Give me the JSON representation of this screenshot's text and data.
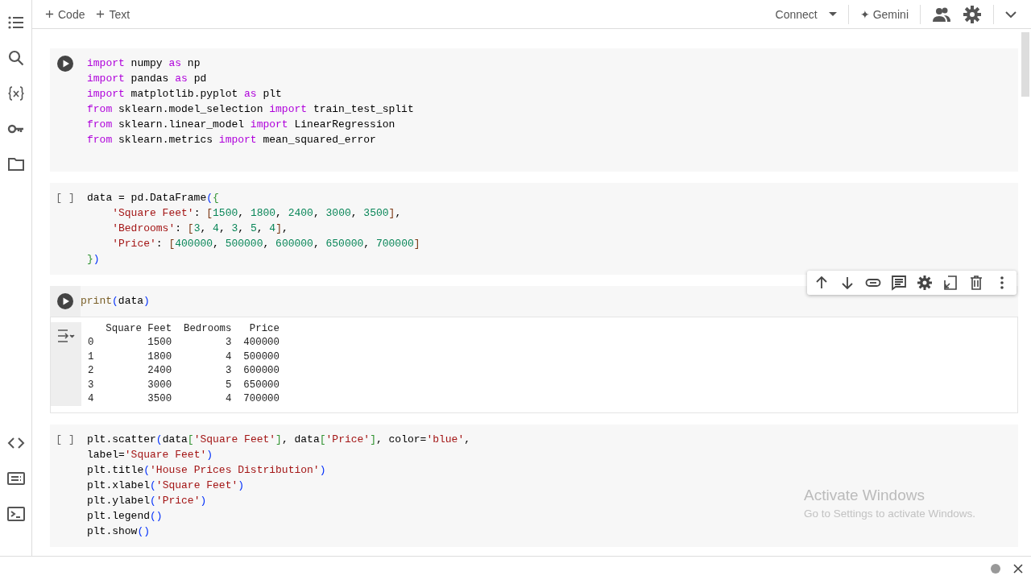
{
  "top_bar": {
    "add_buttons": [
      {
        "label": "Code"
      },
      {
        "label": "Text"
      }
    ],
    "connect": {
      "label": "Connect"
    },
    "gemini": {
      "mark": "✦",
      "label": "Gemini"
    }
  },
  "sidebar": {
    "top_icons": [
      {
        "kind": "toc"
      },
      {
        "kind": "search"
      },
      {
        "kind": "variables"
      },
      {
        "kind": "key"
      },
      {
        "kind": "folder"
      }
    ],
    "bottom_icons": [
      {
        "kind": "code"
      },
      {
        "kind": "command"
      },
      {
        "kind": "terminal"
      }
    ]
  },
  "cells": [
    {
      "selected": false,
      "gutter": {
        "kind": "run"
      },
      "lines": [
        [
          {
            "kind": "kw",
            "text": "import"
          },
          {
            "kind": "id",
            "text": " numpy "
          },
          {
            "kind": "kw",
            "text": "as"
          },
          {
            "kind": "id",
            "text": " np"
          }
        ],
        [
          {
            "kind": "kw",
            "text": "import"
          },
          {
            "kind": "id",
            "text": " pandas "
          },
          {
            "kind": "kw",
            "text": "as"
          },
          {
            "kind": "id",
            "text": " pd"
          }
        ],
        [
          {
            "kind": "kw",
            "text": "import"
          },
          {
            "kind": "id",
            "text": " matplotlib.pyplot "
          },
          {
            "kind": "kw",
            "text": "as"
          },
          {
            "kind": "id",
            "text": " plt"
          }
        ],
        [
          {
            "kind": "kw",
            "text": "from"
          },
          {
            "kind": "id",
            "text": " sklearn.model_selection "
          },
          {
            "kind": "kw",
            "text": "import"
          },
          {
            "kind": "id",
            "text": " train_test_split"
          }
        ],
        [
          {
            "kind": "kw",
            "text": "from"
          },
          {
            "kind": "id",
            "text": " sklearn.linear_model "
          },
          {
            "kind": "kw",
            "text": "import"
          },
          {
            "kind": "id",
            "text": " LinearRegression"
          }
        ],
        [
          {
            "kind": "kw",
            "text": "from"
          },
          {
            "kind": "id",
            "text": " sklearn.metrics "
          },
          {
            "kind": "kw",
            "text": "import"
          },
          {
            "kind": "id",
            "text": " mean_squared_error"
          }
        ]
      ]
    },
    {
      "selected": false,
      "gutter": {
        "kind": "count",
        "text": "[ ]"
      },
      "lines": [
        [
          {
            "kind": "id",
            "text": "data = pd.DataFrame"
          },
          {
            "kind": "b1",
            "text": "("
          },
          {
            "kind": "b2",
            "text": "{"
          }
        ],
        [
          {
            "kind": "indent"
          },
          {
            "kind": "str",
            "text": "'Square Feet'"
          },
          {
            "kind": "id",
            "text": ": "
          },
          {
            "kind": "b3",
            "text": "["
          },
          {
            "kind": "num",
            "text": "1500"
          },
          {
            "kind": "id",
            "text": ", "
          },
          {
            "kind": "num",
            "text": "1800"
          },
          {
            "kind": "id",
            "text": ", "
          },
          {
            "kind": "num",
            "text": "2400"
          },
          {
            "kind": "id",
            "text": ", "
          },
          {
            "kind": "num",
            "text": "3000"
          },
          {
            "kind": "id",
            "text": ", "
          },
          {
            "kind": "num",
            "text": "3500"
          },
          {
            "kind": "b3",
            "text": "]"
          },
          {
            "kind": "id",
            "text": ","
          }
        ],
        [
          {
            "kind": "indent"
          },
          {
            "kind": "str",
            "text": "'Bedrooms'"
          },
          {
            "kind": "id",
            "text": ": "
          },
          {
            "kind": "b3",
            "text": "["
          },
          {
            "kind": "num",
            "text": "3"
          },
          {
            "kind": "id",
            "text": ", "
          },
          {
            "kind": "num",
            "text": "4"
          },
          {
            "kind": "id",
            "text": ", "
          },
          {
            "kind": "num",
            "text": "3"
          },
          {
            "kind": "id",
            "text": ", "
          },
          {
            "kind": "num",
            "text": "5"
          },
          {
            "kind": "id",
            "text": ", "
          },
          {
            "kind": "num",
            "text": "4"
          },
          {
            "kind": "b3",
            "text": "]"
          },
          {
            "kind": "id",
            "text": ","
          }
        ],
        [
          {
            "kind": "indent"
          },
          {
            "kind": "str",
            "text": "'Price'"
          },
          {
            "kind": "id",
            "text": ": "
          },
          {
            "kind": "b3",
            "text": "["
          },
          {
            "kind": "num",
            "text": "400000"
          },
          {
            "kind": "id",
            "text": ", "
          },
          {
            "kind": "num",
            "text": "500000"
          },
          {
            "kind": "id",
            "text": ", "
          },
          {
            "kind": "num",
            "text": "600000"
          },
          {
            "kind": "id",
            "text": ", "
          },
          {
            "kind": "num",
            "text": "650000"
          },
          {
            "kind": "id",
            "text": ", "
          },
          {
            "kind": "num",
            "text": "700000"
          },
          {
            "kind": "b3",
            "text": "]"
          }
        ],
        [
          {
            "kind": "b2",
            "text": "}"
          },
          {
            "kind": "b1",
            "text": ")"
          }
        ]
      ]
    },
    {
      "selected": true,
      "gutter": {
        "kind": "run"
      },
      "toolbar": [
        {
          "kind": "up"
        },
        {
          "kind": "down"
        },
        {
          "kind": "link"
        },
        {
          "kind": "comment"
        },
        {
          "kind": "settings"
        },
        {
          "kind": "mirror"
        },
        {
          "kind": "delete"
        },
        {
          "kind": "more"
        }
      ],
      "lines": [
        [
          {
            "kind": "fn",
            "text": "print"
          },
          {
            "kind": "b1",
            "text": "("
          },
          {
            "kind": "id",
            "text": "data"
          },
          {
            "kind": "b1",
            "text": ")"
          }
        ]
      ],
      "output": {
        "lines": [
          "   Square Feet  Bedrooms   Price",
          "0         1500         3  400000",
          "1         1800         4  500000",
          "2         2400         3  600000",
          "3         3000         5  650000",
          "4         3500         4  700000"
        ]
      }
    },
    {
      "selected": false,
      "gutter": {
        "kind": "count",
        "text": "[ ]"
      },
      "lines": [
        [
          {
            "kind": "id",
            "text": "plt.scatter"
          },
          {
            "kind": "b1",
            "text": "("
          },
          {
            "kind": "id",
            "text": "data"
          },
          {
            "kind": "b2",
            "text": "["
          },
          {
            "kind": "str",
            "text": "'Square Feet'"
          },
          {
            "kind": "b2",
            "text": "]"
          },
          {
            "kind": "id",
            "text": ", data"
          },
          {
            "kind": "b2",
            "text": "["
          },
          {
            "kind": "str",
            "text": "'Price'"
          },
          {
            "kind": "b2",
            "text": "]"
          },
          {
            "kind": "id",
            "text": ", color="
          },
          {
            "kind": "str",
            "text": "'blue'"
          },
          {
            "kind": "id",
            "text": ","
          }
        ],
        [
          {
            "kind": "id",
            "text": "label="
          },
          {
            "kind": "str",
            "text": "'Square Feet'"
          },
          {
            "kind": "b1",
            "text": ")"
          }
        ],
        [
          {
            "kind": "id",
            "text": "plt.title"
          },
          {
            "kind": "b1",
            "text": "("
          },
          {
            "kind": "str",
            "text": "'House Prices Distribution'"
          },
          {
            "kind": "b1",
            "text": ")"
          }
        ],
        [
          {
            "kind": "id",
            "text": "plt.xlabel"
          },
          {
            "kind": "b1",
            "text": "("
          },
          {
            "kind": "str",
            "text": "'Square Feet'"
          },
          {
            "kind": "b1",
            "text": ")"
          }
        ],
        [
          {
            "kind": "id",
            "text": "plt.ylabel"
          },
          {
            "kind": "b1",
            "text": "("
          },
          {
            "kind": "str",
            "text": "'Price'"
          },
          {
            "kind": "b1",
            "text": ")"
          }
        ],
        [
          {
            "kind": "id",
            "text": "plt.legend"
          },
          {
            "kind": "b1",
            "text": "()"
          }
        ],
        [
          {
            "kind": "id",
            "text": "plt.show"
          },
          {
            "kind": "b1",
            "text": "()"
          }
        ]
      ]
    }
  ],
  "activation_notice": {
    "title": "Activate Windows",
    "text": "Go to Settings to activate Windows."
  }
}
